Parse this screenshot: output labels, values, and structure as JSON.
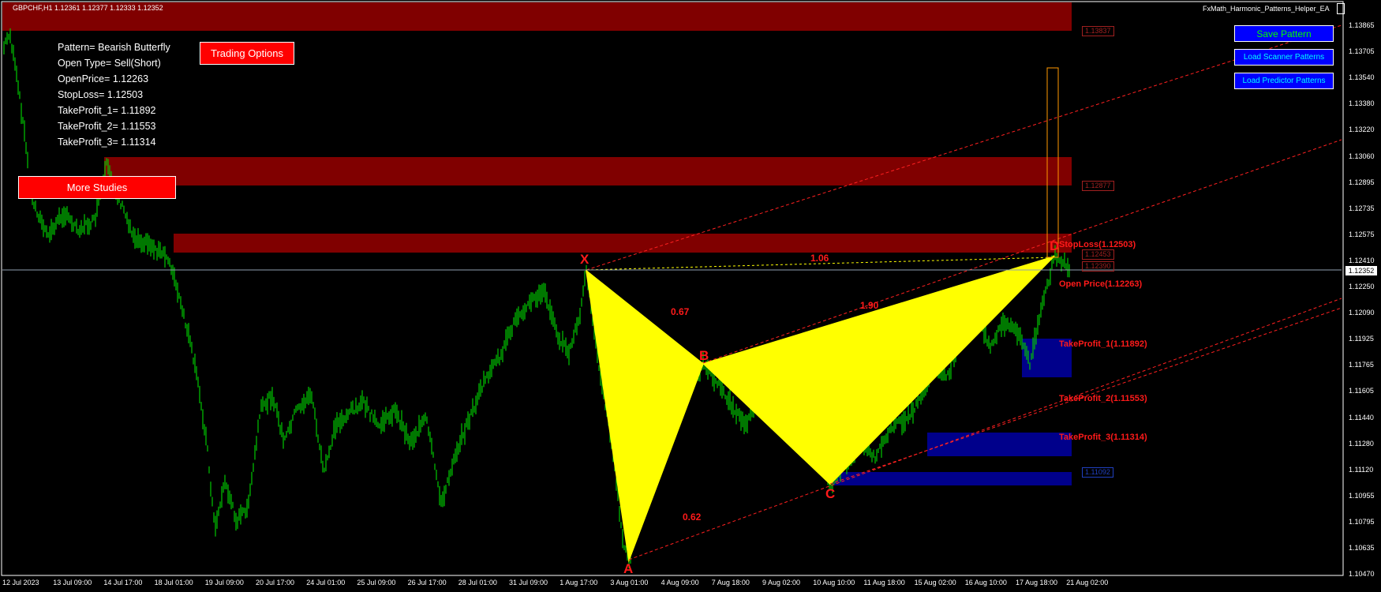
{
  "header": {
    "symbol_info": "GBPCHF,H1  1.12361 1.12377 1.12333 1.12352",
    "ea_name": "FxMath_Harmonic_Patterns_Helper_EA"
  },
  "info_panel": {
    "pattern": "Pattern= Bearish Butterfly",
    "open_type": "Open Type= Sell(Short)",
    "open_price": "OpenPrice= 1.12263",
    "stop_loss": "StopLoss= 1.12503",
    "tp1": "TakeProfit_1= 1.11892",
    "tp2": "TakeProfit_2= 1.11553",
    "tp3": "TakeProfit_3= 1.11314"
  },
  "buttons": {
    "trading_options": "Trading Options",
    "more_studies": "More Studies",
    "save_pattern": "Save Pattern",
    "load_scanner": "Load Scanner Patterns",
    "load_predictor": "Load Predictor Patterns"
  },
  "price_axis": [
    "1.13865",
    "1.13705",
    "1.13540",
    "1.13380",
    "1.13220",
    "1.13060",
    "1.12895",
    "1.12735",
    "1.12575",
    "1.12410",
    "1.12250",
    "1.12090",
    "1.11925",
    "1.11765",
    "1.11605",
    "1.11440",
    "1.11280",
    "1.11120",
    "1.10955",
    "1.10795",
    "1.10635",
    "1.10470"
  ],
  "current_price": "1.12352",
  "time_axis": [
    "12 Jul 2023",
    "13 Jul 09:00",
    "14 Jul 17:00",
    "18 Jul 01:00",
    "19 Jul 09:00",
    "20 Jul 17:00",
    "24 Jul 01:00",
    "25 Jul 09:00",
    "26 Jul 17:00",
    "28 Jul 01:00",
    "31 Jul 09:00",
    "1 Aug 17:00",
    "3 Aug 01:00",
    "4 Aug 09:00",
    "7 Aug 18:00",
    "9 Aug 02:00",
    "10 Aug 10:00",
    "11 Aug 18:00",
    "15 Aug 02:00",
    "16 Aug 10:00",
    "17 Aug 18:00",
    "21 Aug 02:00"
  ],
  "pattern_points": {
    "x": "X",
    "a": "A",
    "b": "B",
    "c": "C",
    "d": "D"
  },
  "ratios": {
    "xb": "0.67",
    "ac": "0.62",
    "bd": "1.90",
    "xd": "1.06"
  },
  "levels": {
    "stop_loss": "StopLoss(1.12503)",
    "open_price": "Open Price(1.12263)",
    "tp1": "TakeProfit_1(1.11892)",
    "tp2": "TakeProfit_2(1.11553)",
    "tp3": "TakeProfit_3(1.11314)"
  },
  "zone_tags": {
    "top": "1.13837",
    "mid": "1.12877",
    "near1": "1.12453",
    "near2": "1.12390",
    "low": "1.11092"
  },
  "colors": {
    "background": "#000000",
    "candles": "#00c800",
    "pattern_fill": "#ffff00",
    "supply_zone": "#800000",
    "demand_zone": "#00008b",
    "label_red": "#ff1a1a"
  }
}
